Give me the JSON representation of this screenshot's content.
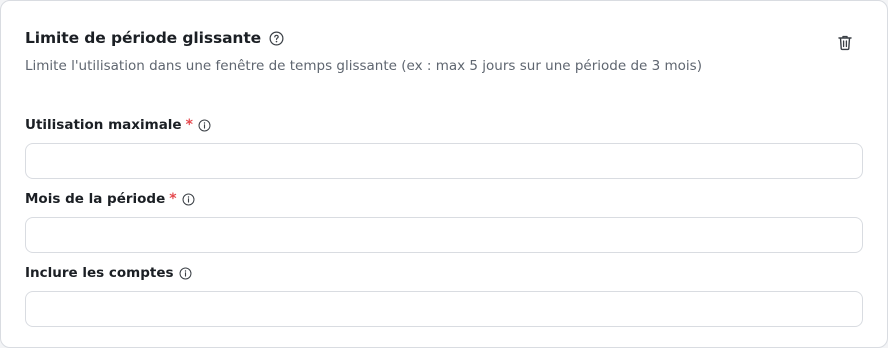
{
  "section": {
    "title": "Limite de période glissante",
    "description": "Limite l'utilisation dans une fenêtre de temps glissante (ex : max 5 jours sur une période de 3 mois)",
    "help_icon": "help-circle-icon",
    "delete_icon": "trash-icon"
  },
  "fields": [
    {
      "label": "Utilisation maximale",
      "required_mark": "*",
      "info_icon": "info-icon",
      "value": "",
      "placeholder": ""
    },
    {
      "label": "Mois de la période",
      "required_mark": "*",
      "info_icon": "info-icon",
      "value": "",
      "placeholder": ""
    },
    {
      "label": "Inclure les comptes",
      "info_icon": "info-icon",
      "value": "",
      "placeholder": ""
    }
  ],
  "colors": {
    "required": "#e5484d",
    "border": "#d9dce1",
    "muted_text": "#5f6670"
  }
}
